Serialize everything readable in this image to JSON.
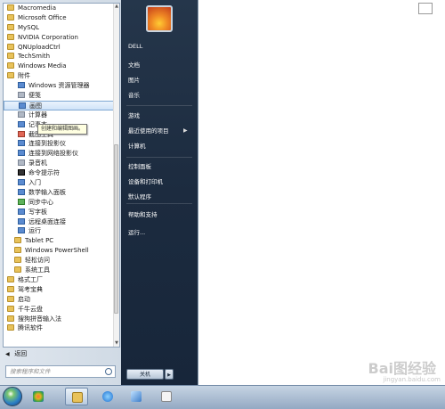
{
  "program_list": [
    {
      "label": "Macromedia",
      "kind": "folder",
      "level": 0
    },
    {
      "label": "Microsoft Office",
      "kind": "folder",
      "level": 0
    },
    {
      "label": "MySQL",
      "kind": "folder",
      "level": 0
    },
    {
      "label": "NVIDIA Corporation",
      "kind": "folder",
      "level": 0
    },
    {
      "label": "QNUploadCtrl",
      "kind": "folder",
      "level": 0
    },
    {
      "label": "TechSmith",
      "kind": "folder",
      "level": 0
    },
    {
      "label": "Windows Media",
      "kind": "folder",
      "level": 0
    },
    {
      "label": "附件",
      "kind": "folder",
      "level": 0
    },
    {
      "label": "Windows 资源管理器",
      "kind": "app",
      "level": 1,
      "color": "blue"
    },
    {
      "label": "便笺",
      "kind": "app",
      "level": 1,
      "color": "gray"
    },
    {
      "label": "画图",
      "kind": "app",
      "level": 1,
      "color": "blue",
      "selected": true
    },
    {
      "label": "计算器",
      "kind": "app",
      "level": 1,
      "color": "gray"
    },
    {
      "label": "记事本",
      "kind": "app",
      "level": 1,
      "color": "blue"
    },
    {
      "label": "截图工具",
      "kind": "app",
      "level": 1,
      "color": "red"
    },
    {
      "label": "连接到投影仪",
      "kind": "app",
      "level": 1,
      "color": "blue"
    },
    {
      "label": "连接到网络投影仪",
      "kind": "app",
      "level": 1,
      "color": "blue"
    },
    {
      "label": "录音机",
      "kind": "app",
      "level": 1,
      "color": "gray"
    },
    {
      "label": "命令提示符",
      "kind": "app",
      "level": 1,
      "color": "dark"
    },
    {
      "label": "入门",
      "kind": "app",
      "level": 1,
      "color": "blue"
    },
    {
      "label": "数学输入面板",
      "kind": "app",
      "level": 1,
      "color": "blue"
    },
    {
      "label": "同步中心",
      "kind": "app",
      "level": 1,
      "color": "green"
    },
    {
      "label": "写字板",
      "kind": "app",
      "level": 1,
      "color": "blue"
    },
    {
      "label": "远程桌面连接",
      "kind": "app",
      "level": 1,
      "color": "blue"
    },
    {
      "label": "运行",
      "kind": "app",
      "level": 1,
      "color": "blue"
    },
    {
      "label": "Tablet PC",
      "kind": "folder",
      "level": 1
    },
    {
      "label": "Windows PowerShell",
      "kind": "folder",
      "level": 1
    },
    {
      "label": "轻松访问",
      "kind": "folder",
      "level": 1
    },
    {
      "label": "系统工具",
      "kind": "folder",
      "level": 1
    },
    {
      "label": "格式工厂",
      "kind": "folder",
      "level": 0
    },
    {
      "label": "驾考宝典",
      "kind": "folder",
      "level": 0
    },
    {
      "label": "启动",
      "kind": "folder",
      "level": 0
    },
    {
      "label": "千牛云盘",
      "kind": "folder",
      "level": 0
    },
    {
      "label": "搜狗拼音输入法",
      "kind": "folder",
      "level": 0
    },
    {
      "label": "腾讯软件",
      "kind": "folder",
      "level": 0
    }
  ],
  "tooltip": "创建和编辑图画。",
  "back_label": "返回",
  "search_placeholder": "搜索程序和文件",
  "right_panel": {
    "items": [
      {
        "label": "DELL"
      },
      {
        "label": "文档"
      },
      {
        "label": "图片"
      },
      {
        "label": "音乐"
      },
      {
        "label": "游戏"
      },
      {
        "label": "最近使用的项目",
        "has_arrow": true
      },
      {
        "label": "计算机"
      },
      {
        "label": "控制面板"
      },
      {
        "label": "设备和打印机"
      },
      {
        "label": "默认程序"
      },
      {
        "label": "帮助和支持"
      },
      {
        "label": "运行..."
      }
    ],
    "shutdown_label": "关机"
  },
  "taskbar_items": [
    "explorer",
    "ie",
    "media",
    "word"
  ],
  "watermark": "Bai图经验",
  "watermark_sub": "jingyan.baidu.com"
}
